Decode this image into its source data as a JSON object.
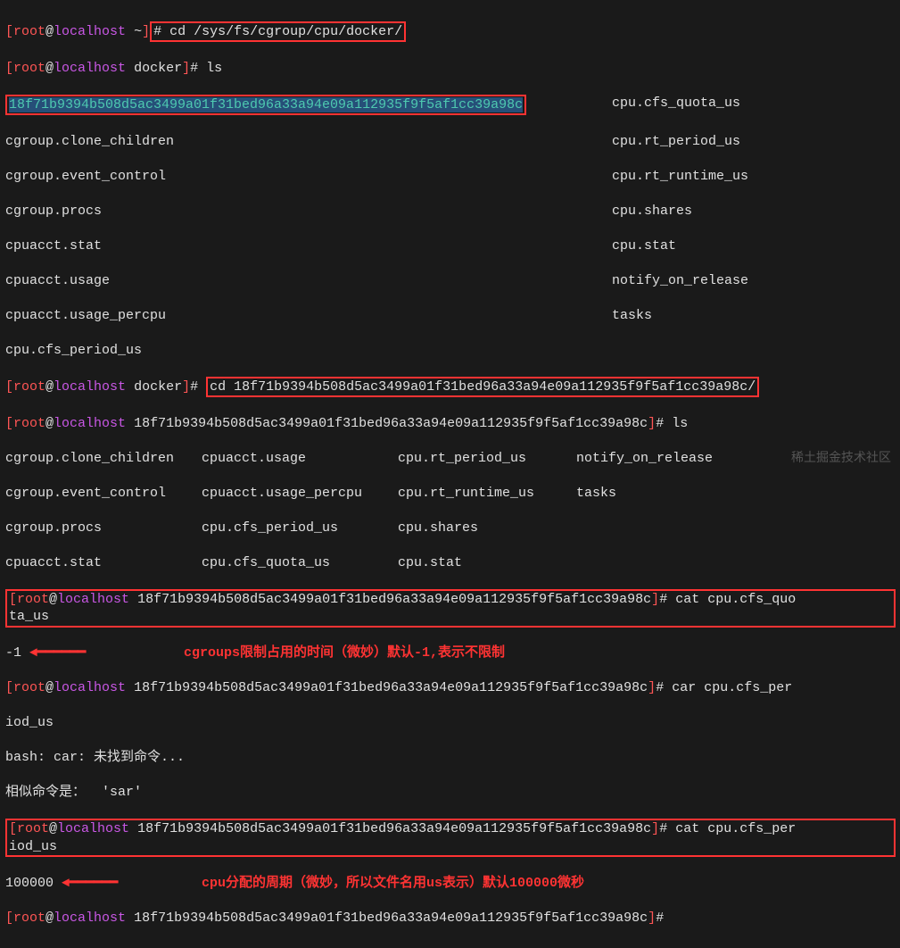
{
  "prompt": {
    "user": "root",
    "at": "@",
    "host": "localhost",
    "home_dir": "~",
    "docker_dir": "docker",
    "hash_dir_short": "18f71b9394b508d5ac3499a01f31bed96a33a94e09a112935f9f5af1cc39a98c",
    "bracket_open": "[",
    "bracket_close": "]",
    "prompt_char": "#"
  },
  "cmd": {
    "cd_cgroup": "cd /sys/fs/cgroup/cpu/docker/",
    "ls": "ls",
    "cd_hash": "cd 18f71b9394b508d5ac3499a01f31bed96a33a94e09a112935f9f5af1cc39a98c/",
    "cat_quota": "cat cpu.cfs_quo",
    "cat_quota2": "ta_us",
    "car_period": "car cpu.cfs_per",
    "iod_us": "iod_us",
    "cat_period": "cat cpu.cfs_per",
    "iod_us2": "iod_us"
  },
  "ls_docker": {
    "hash": "18f71b9394b508d5ac3499a01f31bed96a33a94e09a112935f9f5af1cc39a98c",
    "col1": [
      "cgroup.clone_children",
      "cgroup.event_control",
      "cgroup.procs",
      "cpuacct.stat",
      "cpuacct.usage",
      "cpuacct.usage_percpu",
      "cpu.cfs_period_us"
    ],
    "col2": [
      "cpu.cfs_quota_us",
      "cpu.rt_period_us",
      "cpu.rt_runtime_us",
      "cpu.shares",
      "cpu.stat",
      "notify_on_release",
      "tasks"
    ]
  },
  "ls_hash": {
    "r1": [
      "cgroup.clone_children",
      "cpuacct.usage",
      "cpu.rt_period_us",
      "notify_on_release"
    ],
    "r2": [
      "cgroup.event_control",
      "cpuacct.usage_percpu",
      "cpu.rt_runtime_us",
      "tasks"
    ],
    "r3": [
      "cgroup.procs",
      "cpu.cfs_period_us",
      "cpu.shares",
      ""
    ],
    "r4": [
      "cpuacct.stat",
      "cpu.cfs_quota_us",
      "cpu.stat",
      ""
    ]
  },
  "output": {
    "neg1": "-1",
    "bash_err": "bash: car: 未找到命令...",
    "similar": "相似命令是：  'sar'",
    "hundredk": "100000"
  },
  "annot": {
    "a1": "cgroups限制占用的时间（微妙）默认-1,表示不限制",
    "a2": "cpu分配的周期（微妙，所以文件名用us表示）默认100000微秒"
  },
  "watermark": "稀土掘金技术社区"
}
